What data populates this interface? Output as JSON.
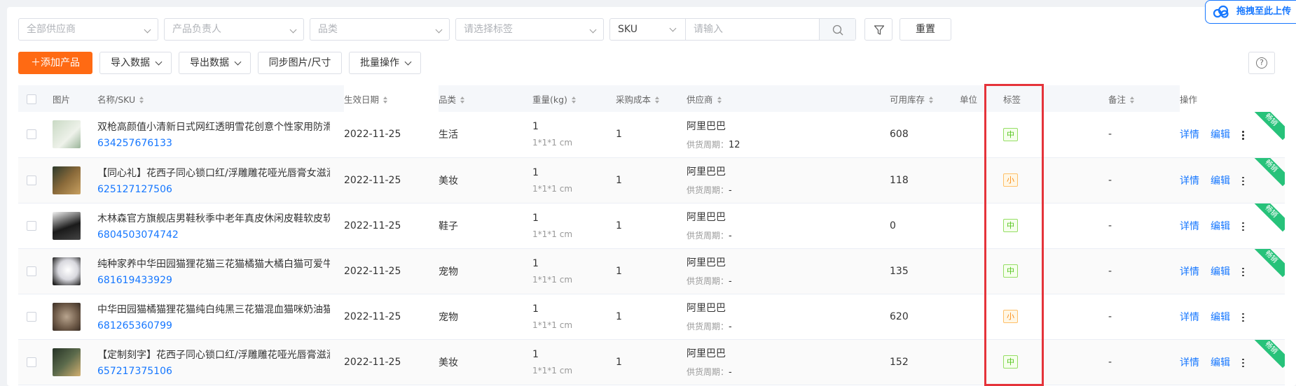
{
  "filters": {
    "supplier_placeholder": "全部供应商",
    "owner_placeholder": "产品负责人",
    "category_placeholder": "品类",
    "tag_placeholder": "请选择标签",
    "sku_type": "SKU",
    "sku_input_placeholder": "请输入",
    "reset_label": "重置"
  },
  "upload_badge": {
    "label": "拖拽至此上传"
  },
  "toolbar": {
    "add_product": "＋添加产品",
    "import_data": "导入数据",
    "export_data": "导出数据",
    "sync_images": "同步图片/尺寸",
    "batch_ops": "批量操作"
  },
  "table": {
    "headers": {
      "image": "图片",
      "name_sku": "名称/SKU",
      "effective_date": "生效日期",
      "category": "品类",
      "weight": "重量(kg)",
      "purchase_cost": "采购成本",
      "supplier": "供应商",
      "stock": "可用库存",
      "unit": "单位",
      "tag": "标签",
      "remark": "备注",
      "actions": "操作"
    },
    "supply_cycle_label": "供货周期：",
    "detail_label": "详情",
    "edit_label": "编辑",
    "ribbon_label": "畅销",
    "rows": [
      {
        "name": "双枪高颜值小清新日式网红透明雪花创意个性家用防滑",
        "sku": "634257676133",
        "date": "2022-11-25",
        "category": "生活",
        "weight": "1",
        "dims": "1*1*1 cm",
        "cost": "1",
        "supplier": "阿里巴巴",
        "cycle": "12",
        "stock": "608",
        "tag": "中",
        "tag_color": "#52c41a",
        "remark": "-",
        "thumb": "#dfe6dd"
      },
      {
        "name": "【同心礼】花西子同心锁口红/浮雕雕花哑光唇膏女滋润",
        "sku": "625127127506",
        "date": "2022-11-25",
        "category": "美妆",
        "weight": "1",
        "dims": "1*1*1 cm",
        "cost": "1",
        "supplier": "阿里巴巴",
        "cycle": "-",
        "stock": "118",
        "tag": "小",
        "tag_color": "#fa8c16",
        "remark": "-",
        "thumb": "#6b5a3a"
      },
      {
        "name": "木林森官方旗舰店男鞋秋季中老年真皮休闲皮鞋软皮软",
        "sku": "6804503074742",
        "date": "2022-11-25",
        "category": "鞋子",
        "weight": "1",
        "dims": "1*1*1 cm",
        "cost": "1",
        "supplier": "阿里巴巴",
        "cycle": "-",
        "stock": "0",
        "tag": "中",
        "tag_color": "#52c41a",
        "remark": "-",
        "thumb": "#2a2a2a"
      },
      {
        "name": "纯种家养中华田园猫狸花猫三花猫橘猫大橘白猫可爱牛",
        "sku": "681619433929",
        "date": "2022-11-25",
        "category": "宠物",
        "weight": "1",
        "dims": "1*1*1 cm",
        "cost": "1",
        "supplier": "阿里巴巴",
        "cycle": "-",
        "stock": "135",
        "tag": "中",
        "tag_color": "#52c41a",
        "remark": "-",
        "thumb": "#e8e8ec"
      },
      {
        "name": "中华田园猫橘猫狸花猫纯白纯黑三花猫混血猫咪奶油猫",
        "sku": "681265360799",
        "date": "2022-11-25",
        "category": "宠物",
        "weight": "1",
        "dims": "1*1*1 cm",
        "cost": "1",
        "supplier": "阿里巴巴",
        "cycle": "-",
        "stock": "620",
        "tag": "小",
        "tag_color": "#fa8c16",
        "remark": "-",
        "thumb": "#8a7766"
      },
      {
        "name": "【定制刻字】花西子同心锁口红/浮雕雕花哑光唇膏滋润",
        "sku": "657217375106",
        "date": "2022-11-25",
        "category": "美妆",
        "weight": "1",
        "dims": "1*1*1 cm",
        "cost": "1",
        "supplier": "阿里巴巴",
        "cycle": "-",
        "stock": "152",
        "tag": "中",
        "tag_color": "#52c41a",
        "remark": "-",
        "thumb": "#3e4a3a"
      }
    ]
  },
  "colors": {
    "primary": "#ff6a13",
    "link": "#1677ff",
    "highlight_box": "#e5333a",
    "ribbon": "#27c27a"
  }
}
